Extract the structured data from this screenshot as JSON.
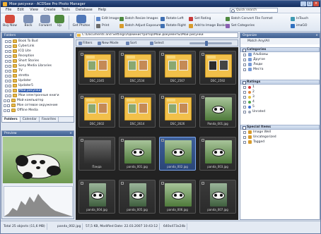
{
  "window": {
    "title": "Мои рисунки - ACDSee Pro Photo Manager"
  },
  "menu": [
    "File",
    "Edit",
    "View",
    "Create",
    "Tools",
    "Database",
    "Help"
  ],
  "search": {
    "placeholder": "Quick search"
  },
  "toolbar": {
    "big": [
      {
        "label": "Buy Now",
        "color": "#d44a3c"
      },
      {
        "label": "Back",
        "color": "#7b8fb5"
      },
      {
        "label": "Forward",
        "color": "#7b8fb5"
      },
      {
        "label": "Up",
        "color": "#4f8a3f"
      },
      {
        "label": "Get Photos",
        "color": "#4f77b8"
      }
    ],
    "small": [
      {
        "label": "Edit Image",
        "color": "#5d86c9"
      },
      {
        "label": "Print",
        "color": "#6b6b6b"
      },
      {
        "label": "Batch Resize Images",
        "color": "#4f8a3f"
      },
      {
        "label": "Batch Adjust Exposure",
        "color": "#d79b2c"
      },
      {
        "label": "Rotate Left",
        "color": "#3f6fb2"
      },
      {
        "label": "Rotate Right",
        "color": "#3f6fb2"
      },
      {
        "label": "Set Rating",
        "color": "#c73a3a"
      },
      {
        "label": "Add to Image Basket",
        "color": "#d79b2c"
      },
      {
        "label": "Batch Convert File Format",
        "color": "#4f8a3f"
      },
      {
        "label": "Set Categories",
        "color": "#8a5fb2"
      },
      {
        "label": "InTouch",
        "color": "#3f9ab2"
      },
      {
        "label": "imaGO",
        "color": "#2f6fbf"
      }
    ]
  },
  "folders": {
    "header": "Folders",
    "items": [
      {
        "label": "Book To Bud",
        "level": 2
      },
      {
        "label": "CyberLink",
        "level": 2
      },
      {
        "label": "ICQ Lite",
        "level": 2
      },
      {
        "label": "Reception",
        "level": 2
      },
      {
        "label": "Short Stories",
        "level": 2
      },
      {
        "label": "Sony Media Libraries",
        "level": 2
      },
      {
        "label": "TV",
        "level": 2
      },
      {
        "label": "stretta",
        "level": 2
      },
      {
        "label": "Updater",
        "level": 2
      },
      {
        "label": "Updater5",
        "level": 2
      },
      {
        "label": "Мои рисунки",
        "level": 2,
        "selected": true
      },
      {
        "label": "Мои электронные книги",
        "level": 2
      },
      {
        "label": "Мой компьютер",
        "level": 1
      },
      {
        "label": "Мое сетевое окружение",
        "level": 1
      },
      {
        "label": "Offline Media",
        "level": 1
      }
    ],
    "tabs": [
      "Folders",
      "Calendar",
      "Favorites"
    ]
  },
  "preview": {
    "header": "Preview"
  },
  "address": "C:\\Documents and Settings\\Администратор\\Мои документы\\Мои рисунки",
  "filterbar": [
    "Filters",
    "New Mode",
    "Sort",
    "Select"
  ],
  "thumbnails": [
    {
      "caption": "DSC_2345",
      "kind": "folder"
    },
    {
      "caption": "DSC_2534",
      "kind": "folder"
    },
    {
      "caption": "DSC_2567",
      "kind": "folder"
    },
    {
      "caption": "DSC_2592",
      "kind": "folder-dark"
    },
    {
      "caption": "DSC_2602",
      "kind": "folder"
    },
    {
      "caption": "DSC_2614",
      "kind": "folder"
    },
    {
      "caption": "DSC_2626",
      "kind": "folder"
    },
    {
      "caption": "Panda_001.jpg",
      "kind": "photo"
    },
    {
      "caption": "Панда",
      "kind": "dark"
    },
    {
      "caption": "panda_001.jpg",
      "kind": "photo"
    },
    {
      "caption": "panda_002.jpg",
      "kind": "photo",
      "selected": true
    },
    {
      "caption": "panda_003.jpg",
      "kind": "photo"
    },
    {
      "caption": "panda_004.jpg",
      "kind": "port"
    },
    {
      "caption": "panda_005.jpg",
      "kind": "port"
    },
    {
      "caption": "panda_006.jpg",
      "kind": "photo"
    },
    {
      "caption": "panda_007.jpg",
      "kind": "port"
    }
  ],
  "organizer": {
    "header": "Organize",
    "toolbar": "Match Any/All",
    "categories": {
      "title": "Categories",
      "items": [
        "Альбомы",
        "Другое",
        "Люди",
        "Места"
      ]
    },
    "ratings": {
      "title": "Ratings",
      "items": [
        "1",
        "2",
        "3",
        "4",
        "5",
        "Unrated"
      ],
      "colors": [
        "#d73a3a",
        "#e0863a",
        "#e2c13a",
        "#4fa64a",
        "#3a6fd7",
        "#9aa3b5"
      ]
    },
    "special": {
      "title": "Special Items",
      "items": [
        "Image Well",
        "Uncategorized",
        "Tagged"
      ]
    }
  },
  "status": {
    "total": "Total 25 objects (11,6 MB)",
    "file": "panda_002.jpg",
    "size": "57,5 KB, Modified Date: 22.03.2007 10:43:12",
    "dims": "640x473x24b"
  }
}
